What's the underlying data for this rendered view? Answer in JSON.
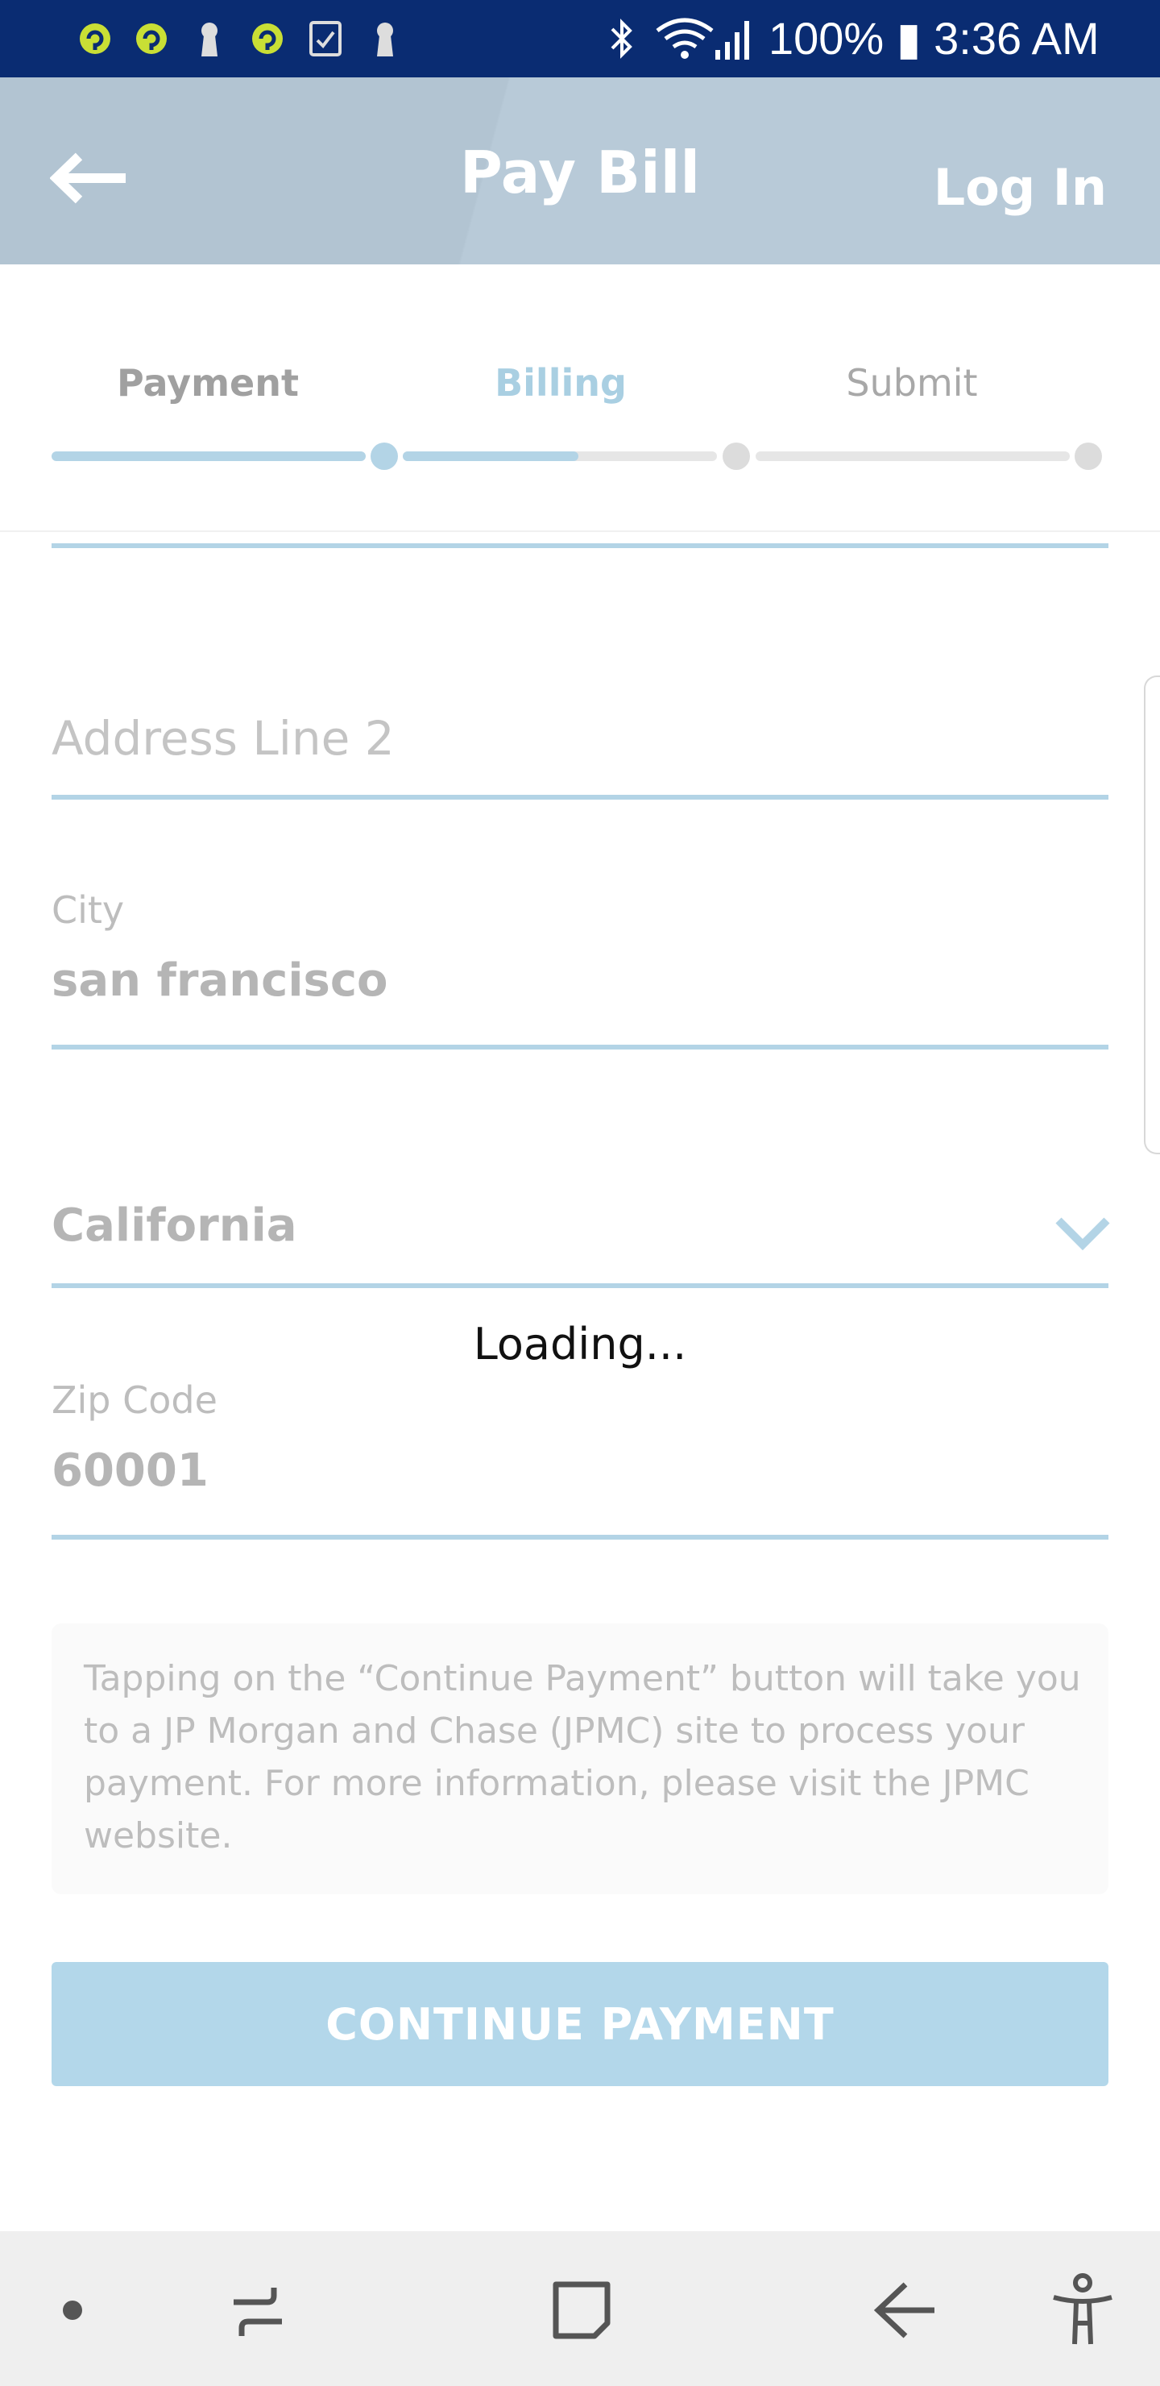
{
  "status_bar": {
    "text": "100% ▮ 3:36 AM",
    "icons_left": [
      "app-icon-green",
      "app-icon-green",
      "keyhole-icon",
      "app-icon-green",
      "task-check-icon",
      "keyhole-icon"
    ],
    "icons_right": [
      "bluetooth-icon",
      "wifi-icon",
      "signal-icon"
    ]
  },
  "header": {
    "title": "Pay Bill",
    "login_label": "Log In",
    "back_icon": "arrow-left-icon"
  },
  "stepper": {
    "steps": [
      {
        "label": "Payment",
        "state": "done"
      },
      {
        "label": "Billing",
        "state": "current"
      },
      {
        "label": "Submit",
        "state": "upcoming"
      }
    ]
  },
  "form": {
    "address_line2_placeholder": "Address Line 2",
    "city_label": "City",
    "city_value": "san francisco",
    "state_value": "California",
    "zip_label": "Zip Code",
    "zip_value": "60001"
  },
  "loading_text": "Loading...",
  "notice_text": "Tapping on the “Continue Payment” button will take you to a JP Morgan and Chase (JPMC) site to process your payment. For more information, please visit the JPMC website.",
  "continue_button": "CONTINUE PAYMENT",
  "colors": {
    "status_bar": "#0a2c72",
    "header": "#b2c4d2",
    "accent": "#b3d4e6",
    "button": "#b3d7ea"
  },
  "nav_bar": {
    "items": [
      "dot-icon",
      "recents-icon",
      "home-icon",
      "back-icon",
      "accessibility-icon"
    ]
  }
}
